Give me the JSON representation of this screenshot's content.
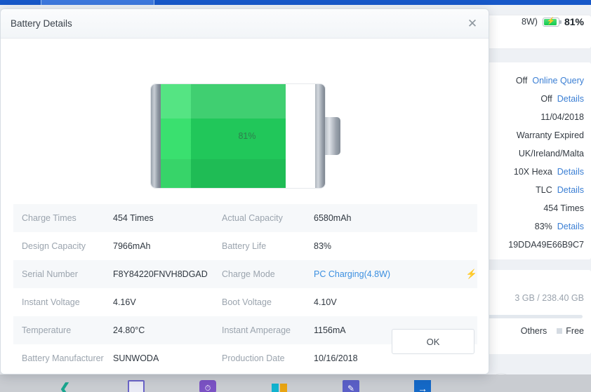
{
  "dialog": {
    "title": "Battery Details",
    "close_icon": "close-icon",
    "battery": {
      "percent_label": "81%",
      "fill_percent": 81
    },
    "rows": [
      {
        "label": "Charge Times",
        "value": "454 Times",
        "label2": "Actual Capacity",
        "value2": "6580mAh",
        "value2_is_link": false,
        "value2_has_bolt": false
      },
      {
        "label": "Design Capacity",
        "value": "7966mAh",
        "label2": "Battery Life",
        "value2": "83%",
        "value2_is_link": false,
        "value2_has_bolt": false
      },
      {
        "label": "Serial Number",
        "value": "F8Y84220FNVH8DGAD",
        "label2": "Charge Mode",
        "value2": "PC Charging(4.8W)",
        "value2_is_link": true,
        "value2_has_bolt": true
      },
      {
        "label": "Instant Voltage",
        "value": "4.16V",
        "label2": "Boot Voltage",
        "value2": "4.10V",
        "value2_is_link": false,
        "value2_has_bolt": false
      },
      {
        "label": "Temperature",
        "value": "24.80°C",
        "label2": "Instant Amperage",
        "value2": "1156mA",
        "value2_is_link": false,
        "value2_has_bolt": false
      },
      {
        "label": "Battery Manufacturer",
        "value": "SUNWODA",
        "label2": "Production Date",
        "value2": "10/16/2018",
        "value2_is_link": false,
        "value2_has_bolt": false
      }
    ],
    "ok_label": "OK"
  },
  "background_panel": {
    "battery_status": {
      "prefix_text": "8W)",
      "icon": "battery-charging-icon",
      "percent": "81%"
    },
    "info_lines": [
      {
        "text": "Off",
        "link": "Online Query"
      },
      {
        "text": "Off",
        "link": "Details"
      },
      {
        "text": "11/04/2018",
        "link": ""
      },
      {
        "text": "Warranty Expired",
        "link": ""
      },
      {
        "text": "UK/Ireland/Malta",
        "link": ""
      },
      {
        "text": "10X Hexa",
        "link": "Details"
      },
      {
        "text": "TLC",
        "link": "Details"
      },
      {
        "text": "454 Times",
        "link": ""
      },
      {
        "text": "83%",
        "link": "Details"
      },
      {
        "text": "19DDA49E66B9C7",
        "link": ""
      }
    ],
    "storage_text": "3 GB / 238.40 GB",
    "storage_legend": [
      {
        "label": "Others"
      },
      {
        "label": "Free"
      }
    ],
    "add_button_icon": "plus-icon"
  },
  "taskbar": {
    "icons": [
      "double-chevron-down-icon",
      "note-icon",
      "shield-clock-icon",
      "color-squares-icon",
      "edit-pencil-icon",
      "arrow-right-icon"
    ]
  }
}
